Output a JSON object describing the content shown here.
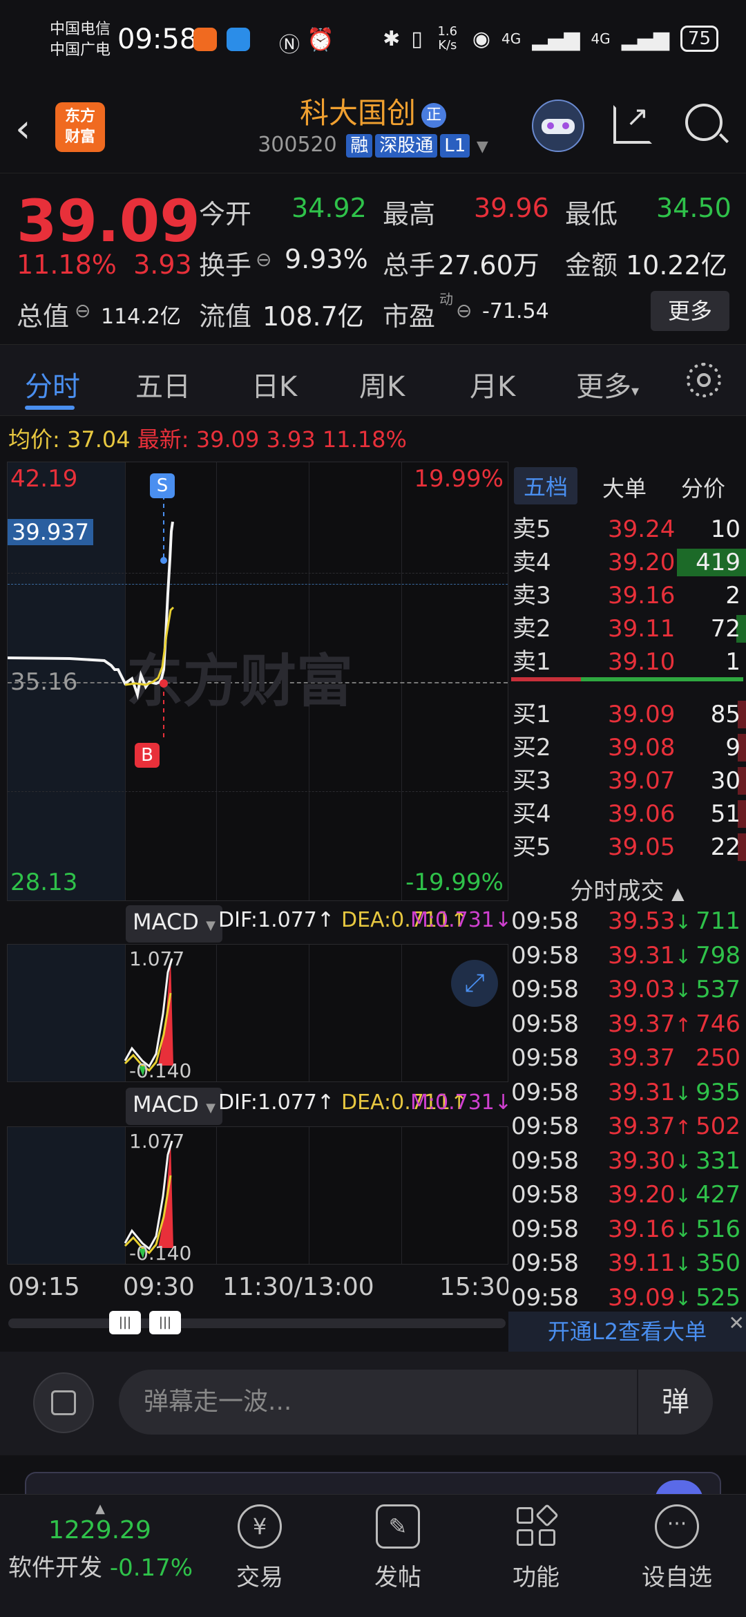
{
  "status_bar": {
    "carrier1": "中国电信",
    "carrier2": "中国广电",
    "time": "09:58",
    "net_speed": "1.6 K/s",
    "net1": "4G",
    "net2": "4G",
    "battery": "75"
  },
  "header": {
    "logo_text1": "东方",
    "logo_text2": "财富",
    "stock_name": "科大国创",
    "name_badge": "正",
    "code": "300520",
    "tags": [
      "融",
      "深股通",
      "L1"
    ]
  },
  "quote": {
    "price": "39.09",
    "change_pct": "11.18%",
    "change": "3.93",
    "open_label": "今开",
    "open": "34.92",
    "high_label": "最高",
    "high": "39.96",
    "low_label": "最低",
    "low": "34.50",
    "turnover_label": "换手",
    "turnover": "9.93%",
    "volume_label": "总手",
    "volume": "27.60万",
    "amount_label": "金额",
    "amount": "10.22亿",
    "mktcap_label": "总值",
    "mktcap": "114.2亿",
    "float_label": "流值",
    "float": "108.7亿",
    "pe_label": "市盈",
    "pe_sup": "动",
    "pe": "-71.54",
    "more_button": "更多"
  },
  "tabs": [
    "分时",
    "五日",
    "日K",
    "周K",
    "月K",
    "更多"
  ],
  "avg_bar": {
    "avg_label": "均价:",
    "avg": "37.04",
    "latest_label": "最新:",
    "latest": "39.09",
    "change": "3.93",
    "change_pct": "11.18%"
  },
  "chart": {
    "y_top": "42.19",
    "y_top_pct": "19.99%",
    "y_mid": "35.16",
    "y_bottom": "28.13",
    "y_bottom_pct": "-19.99%",
    "price_flag": "39.937",
    "sell_marker": "S",
    "buy_marker": "B",
    "watermark": "东方财富",
    "x_labels": [
      "09:15",
      "09:30",
      "11:30/13:00",
      "15:30"
    ]
  },
  "macd": [
    {
      "label": "MACD",
      "dif": "DIF:1.077↑",
      "dea": "DEA:0.711↑",
      "m": "M:0.731↓",
      "top": "1.077",
      "bottom": "-0.140"
    },
    {
      "label": "MACD",
      "dif": "DIF:1.077↑",
      "dea": "DEA:0.711↑",
      "m": "M:0.731↓",
      "top": "1.077",
      "bottom": "-0.140"
    }
  ],
  "book": {
    "tabs": [
      "五档",
      "大单",
      "分价"
    ],
    "sells": [
      {
        "label": "卖5",
        "price": "39.24",
        "vol": "10"
      },
      {
        "label": "卖4",
        "price": "39.20",
        "vol": "419"
      },
      {
        "label": "卖3",
        "price": "39.16",
        "vol": "2"
      },
      {
        "label": "卖2",
        "price": "39.11",
        "vol": "72"
      },
      {
        "label": "卖1",
        "price": "39.10",
        "vol": "1"
      }
    ],
    "buys": [
      {
        "label": "买1",
        "price": "39.09",
        "vol": "85"
      },
      {
        "label": "买2",
        "price": "39.08",
        "vol": "9"
      },
      {
        "label": "买3",
        "price": "39.07",
        "vol": "30"
      },
      {
        "label": "买4",
        "price": "39.06",
        "vol": "51"
      },
      {
        "label": "买5",
        "price": "39.05",
        "vol": "22"
      }
    ],
    "trades_title": "分时成交",
    "trades": [
      {
        "time": "09:58",
        "price": "39.53",
        "dir": "↓",
        "vol": "711",
        "color": "#2fc24a"
      },
      {
        "time": "09:58",
        "price": "39.31",
        "dir": "↓",
        "vol": "798",
        "color": "#2fc24a"
      },
      {
        "time": "09:58",
        "price": "39.03",
        "dir": "↓",
        "vol": "537",
        "color": "#2fc24a"
      },
      {
        "time": "09:58",
        "price": "39.37",
        "dir": "↑",
        "vol": "746",
        "color": "#e8303a"
      },
      {
        "time": "09:58",
        "price": "39.37",
        "dir": "",
        "vol": "250",
        "color": "#e8303a"
      },
      {
        "time": "09:58",
        "price": "39.31",
        "dir": "↓",
        "vol": "935",
        "color": "#2fc24a"
      },
      {
        "time": "09:58",
        "price": "39.37",
        "dir": "↑",
        "vol": "502",
        "color": "#e8303a"
      },
      {
        "time": "09:58",
        "price": "39.30",
        "dir": "↓",
        "vol": "331",
        "color": "#2fc24a"
      },
      {
        "time": "09:58",
        "price": "39.20",
        "dir": "↓",
        "vol": "427",
        "color": "#2fc24a"
      },
      {
        "time": "09:58",
        "price": "39.16",
        "dir": "↓",
        "vol": "516",
        "color": "#2fc24a"
      },
      {
        "time": "09:58",
        "price": "39.11",
        "dir": "↓",
        "vol": "350",
        "color": "#2fc24a"
      },
      {
        "time": "09:58",
        "price": "39.09",
        "dir": "↓",
        "vol": "525",
        "color": "#2fc24a"
      }
    ],
    "l2_banner": "开通L2查看大单"
  },
  "comment": {
    "placeholder": "弹幕走一波...",
    "dan_button": "弹"
  },
  "bottom_nav": {
    "index_value": "1229.29",
    "index_name": "软件开发",
    "index_change": "-0.17%",
    "items": [
      "交易",
      "发帖",
      "功能",
      "设自选"
    ]
  }
}
